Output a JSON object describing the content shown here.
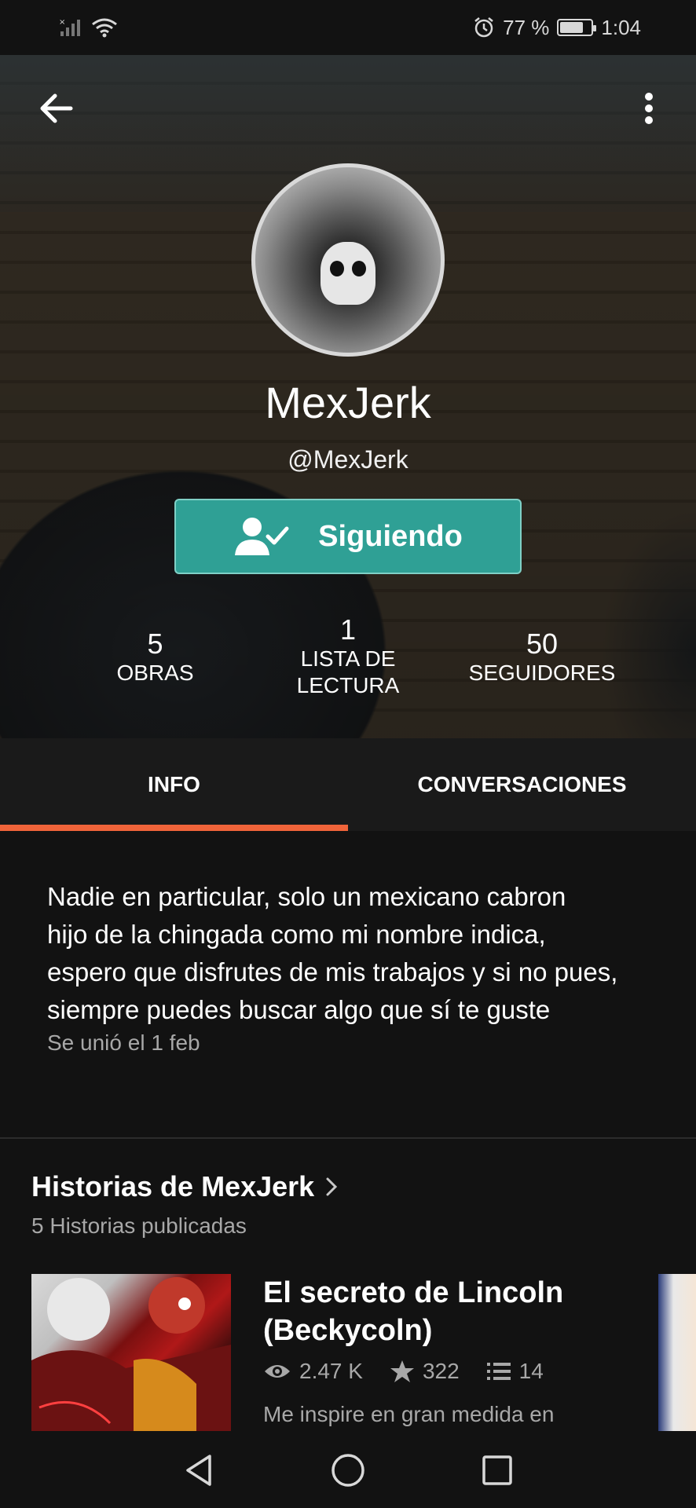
{
  "status_bar": {
    "battery": "77 %",
    "battery_level": 0.77,
    "time": "1:04"
  },
  "profile": {
    "display_name": "MexJerk",
    "handle": "@MexJerk",
    "follow_label": "Siguiendo"
  },
  "stats": [
    {
      "value": "5",
      "label": "OBRAS"
    },
    {
      "value": "1",
      "label": "LISTA DE LECTURA"
    },
    {
      "value": "50",
      "label": "SEGUIDORES"
    }
  ],
  "tabs": [
    {
      "label": "INFO",
      "active": true
    },
    {
      "label": "CONVERSACIONES",
      "active": false
    }
  ],
  "bio": {
    "lines": [
      "Nadie en particular, solo un mexicano cabron",
      "hijo de la chingada como mi nombre indica,",
      "espero que disfrutes de mis trabajos y si no pues,",
      "siempre puedes buscar algo que sí te guste"
    ],
    "joined": "Se unió el 1 feb"
  },
  "stories": {
    "title": "Historias de MexJerk",
    "subtitle": "5 Historias publicadas",
    "items": [
      {
        "title_line1": "El secreto de Lincoln",
        "title_line2": "(Beckycoln)",
        "reads": "2.47 K",
        "votes": "322",
        "parts": "14",
        "description": "Me inspire en gran medida en"
      }
    ]
  },
  "colors": {
    "accent_teal": "#2fa095",
    "tab_indicator": "#f0643a",
    "background": "#121212"
  }
}
